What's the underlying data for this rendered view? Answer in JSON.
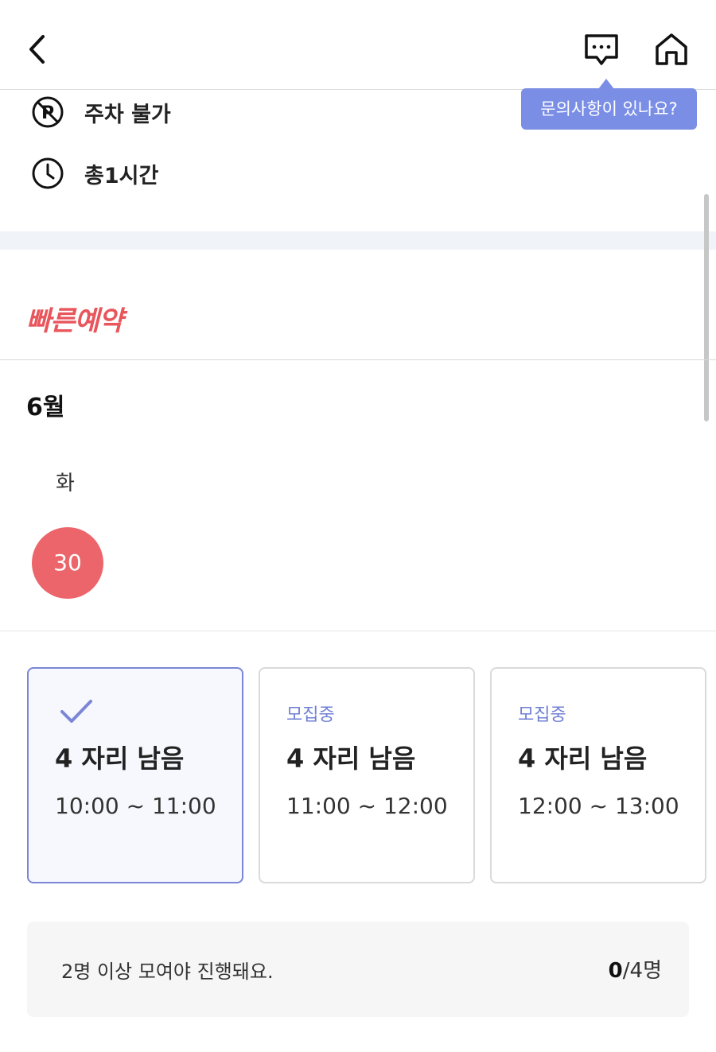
{
  "header": {
    "back_icon": "chevron-left-icon",
    "chat_icon": "chat-bubble-icon",
    "home_icon": "home-icon"
  },
  "tooltip": {
    "text": "문의사항이 있나요?"
  },
  "info": [
    {
      "icon": "no-parking-icon",
      "label": "주차 불가"
    },
    {
      "icon": "clock-icon",
      "label": "총1시간"
    }
  ],
  "quick_reservation": {
    "title": "빠른예약"
  },
  "calendar": {
    "month": "6월",
    "weekday": "화",
    "date": "30"
  },
  "slots": [
    {
      "status": "",
      "selected": true,
      "seats": "4 자리 남음",
      "time": "10:00 ~ 11:00"
    },
    {
      "status": "모집중",
      "selected": false,
      "seats": "4 자리 남음",
      "time": "11:00 ~ 12:00"
    },
    {
      "status": "모집중",
      "selected": false,
      "seats": "4 자리 남음",
      "time": "12:00 ~ 13:00"
    }
  ],
  "notice": {
    "message": "2명 이상 모여야 진행돼요.",
    "count_current": "0",
    "count_total": "/4명"
  },
  "colors": {
    "accent": "#7b8ee6",
    "brand_red": "#e8555b",
    "date_circle": "#ec656a",
    "status_text": "#6f7fd4"
  }
}
